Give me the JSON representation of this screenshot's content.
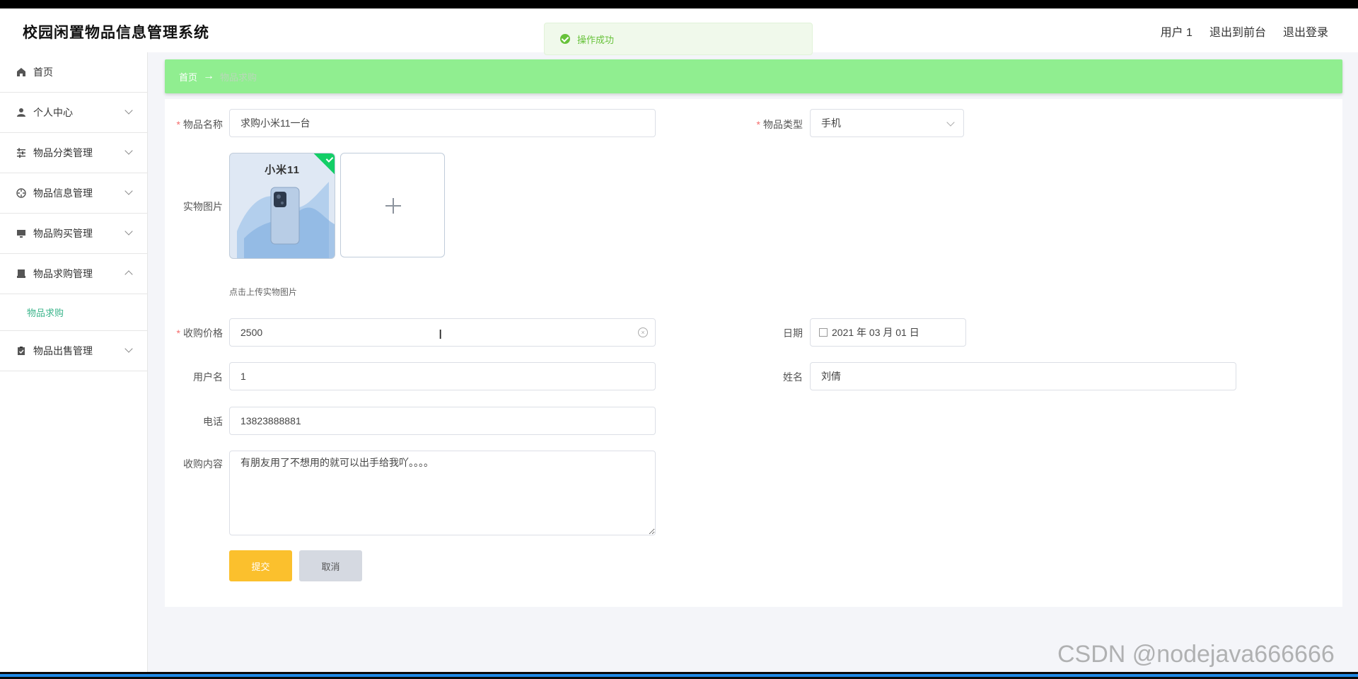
{
  "app": {
    "title": "校园闲置物品信息管理系统"
  },
  "header": {
    "user": "用户 1",
    "back_to_front": "退出到前台",
    "logout": "退出登录"
  },
  "toast": {
    "message": "操作成功"
  },
  "sidebar": {
    "items": [
      {
        "label": "首页",
        "icon": "home-icon"
      },
      {
        "label": "个人中心",
        "icon": "user-icon"
      },
      {
        "label": "物品分类管理",
        "icon": "sliders-icon"
      },
      {
        "label": "物品信息管理",
        "icon": "compass-icon"
      },
      {
        "label": "物品购买管理",
        "icon": "monitor-icon"
      },
      {
        "label": "物品求购管理",
        "icon": "printer-icon",
        "expanded": true
      },
      {
        "label": "物品出售管理",
        "icon": "clipboard-icon"
      }
    ],
    "sub_items": {
      "want_to_buy": "物品求购"
    }
  },
  "breadcrumb": {
    "home": "首页",
    "arrow": "→",
    "current": "物品求购"
  },
  "form": {
    "item_name": {
      "label": "物品名称",
      "required": "*",
      "value": "求购小米11一台"
    },
    "item_type": {
      "label": "物品类型",
      "required": "*",
      "value": "手机"
    },
    "photo": {
      "label": "实物图片",
      "tip": "点击上传实物图片",
      "thumb_brand": "小米11"
    },
    "price": {
      "label": "收购价格",
      "required": "*",
      "value": "2500"
    },
    "date": {
      "label": "日期",
      "value": "2021 年 03 月 01 日"
    },
    "username": {
      "label": "用户名",
      "value": "1"
    },
    "name": {
      "label": "姓名",
      "value": "刘倩"
    },
    "phone": {
      "label": "电话",
      "value": "13823888881"
    },
    "content": {
      "label": "收购内容",
      "value": "有朋友用了不想用的就可以出手给我吖。。。。"
    },
    "submit_label": "提交",
    "cancel_label": "取消"
  },
  "watermark": "CSDN @nodejava666666",
  "colors": {
    "accent_green": "#90ee90",
    "submit_yellow": "#fbc02d",
    "active_menu": "#3cb58c"
  }
}
